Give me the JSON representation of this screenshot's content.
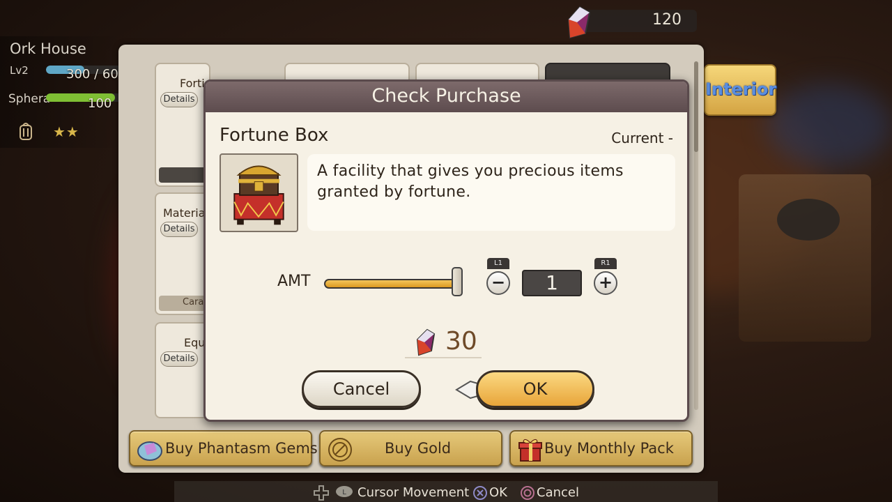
{
  "status": {
    "location": "Ork House",
    "level_label": "Lv2",
    "level_value": "300 / 60",
    "level_progress": 0.5,
    "sphera_label": "Sphera",
    "sphera_value": "100",
    "sphera_progress": 0.9,
    "stars": "★★"
  },
  "currency": {
    "gems": "120"
  },
  "side_tab": {
    "label": "Interior"
  },
  "shop": {
    "cards": [
      {
        "name": "Forti",
        "details": "Details"
      },
      {
        "name": "Materia",
        "details": "Details",
        "footer": "Cara"
      },
      {
        "name": "Equ",
        "details": "Details"
      }
    ],
    "buy_buttons": [
      {
        "label": "Buy Phantasm Gems",
        "icon": "phantasm-gem-icon"
      },
      {
        "label": "Buy Gold",
        "icon": "gold-coin-icon"
      },
      {
        "label": "Buy Monthly Pack",
        "icon": "gift-box-icon"
      }
    ]
  },
  "dialog": {
    "title": "Check Purchase",
    "item_name": "Fortune Box",
    "current": "Current -",
    "description": "A facility that gives you precious items granted by fortune.",
    "amount_label": "AMT",
    "amount_slider_fraction": 1.0,
    "quantity": "1",
    "minus_label": "−",
    "plus_label": "+",
    "l1_label": "L1",
    "r1_label": "R1",
    "price": "30",
    "cancel_label": "Cancel",
    "ok_label": "OK"
  },
  "hints": {
    "cursor": "Cursor Movement",
    "ok": "OK",
    "cancel": "Cancel"
  },
  "colors": {
    "header": "#5d4c4e",
    "ok_button": "#e8a53a",
    "price_text": "#6e4a28",
    "interior_text": "#5a8ee0"
  }
}
